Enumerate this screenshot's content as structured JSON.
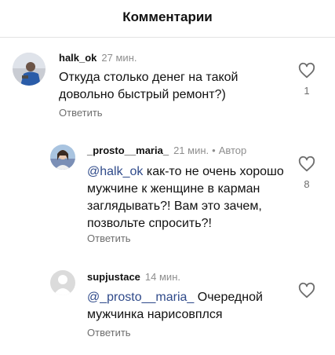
{
  "header": {
    "title": "Комментарии"
  },
  "comments": [
    {
      "username": "halk_ok",
      "time": "27 мин.",
      "text": "Откуда столько денег на такой довольно быстрый ремонт?)",
      "reply_label": "Ответить",
      "likes": "1"
    },
    {
      "username": "_prosto__maria_",
      "time": "21 мин.",
      "separator": "•",
      "author_badge": "Автор",
      "mention": "@halk_ok",
      "text": "как-то не очень хорошо мужчине к женщине в карман заглядывать?! Вам это зачем, позвольте спросить?!",
      "reply_label": "Ответить",
      "likes": "8"
    },
    {
      "username": "supjustace",
      "time": "14 мин.",
      "mention": "@_prosto__maria_",
      "text": "Очередной мужчинка нарисовплся",
      "reply_label": "Ответить"
    }
  ],
  "colors": {
    "mention": "#2f4a8a",
    "muted": "#8e8e8e"
  },
  "icons": {
    "like": "heart-outline-icon"
  }
}
